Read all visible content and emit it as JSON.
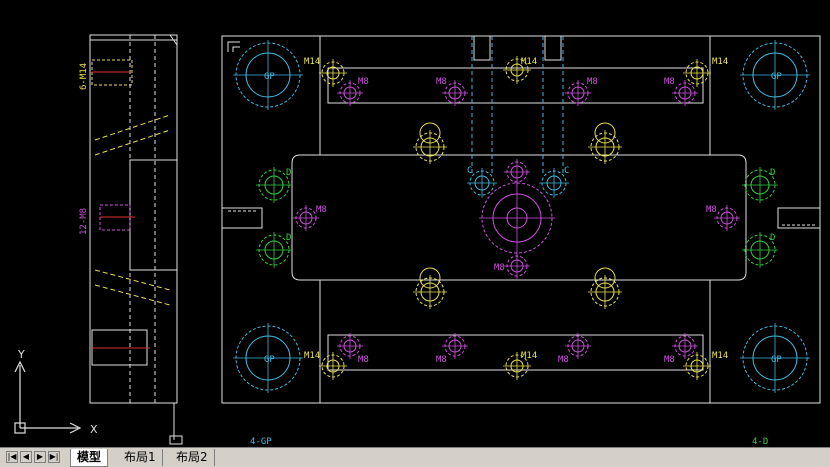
{
  "colors": {
    "yellow": "#e8e050",
    "magenta": "#d050e0",
    "cyan": "#40b8e0",
    "green": "#30d040",
    "white": "#e0e0e0",
    "red": "#e03030"
  },
  "side_view": {
    "top_label": "6-M14",
    "mid_label": "12-M8"
  },
  "plan": {
    "gp_label": "GP",
    "m14_label": "M14",
    "m8_label": "M8",
    "c_label": "C",
    "d_label": "D",
    "bottom_left_label": "4-GP",
    "bottom_right_label": "4-D"
  },
  "ucs": {
    "x_label": "X",
    "y_label": "Y"
  },
  "tabs": [
    {
      "label": "模型",
      "active": true
    },
    {
      "label": "布局1",
      "active": false
    },
    {
      "label": "布局2",
      "active": false
    }
  ],
  "nav_icons": [
    "first-icon",
    "prev-icon",
    "next-icon",
    "last-icon"
  ]
}
